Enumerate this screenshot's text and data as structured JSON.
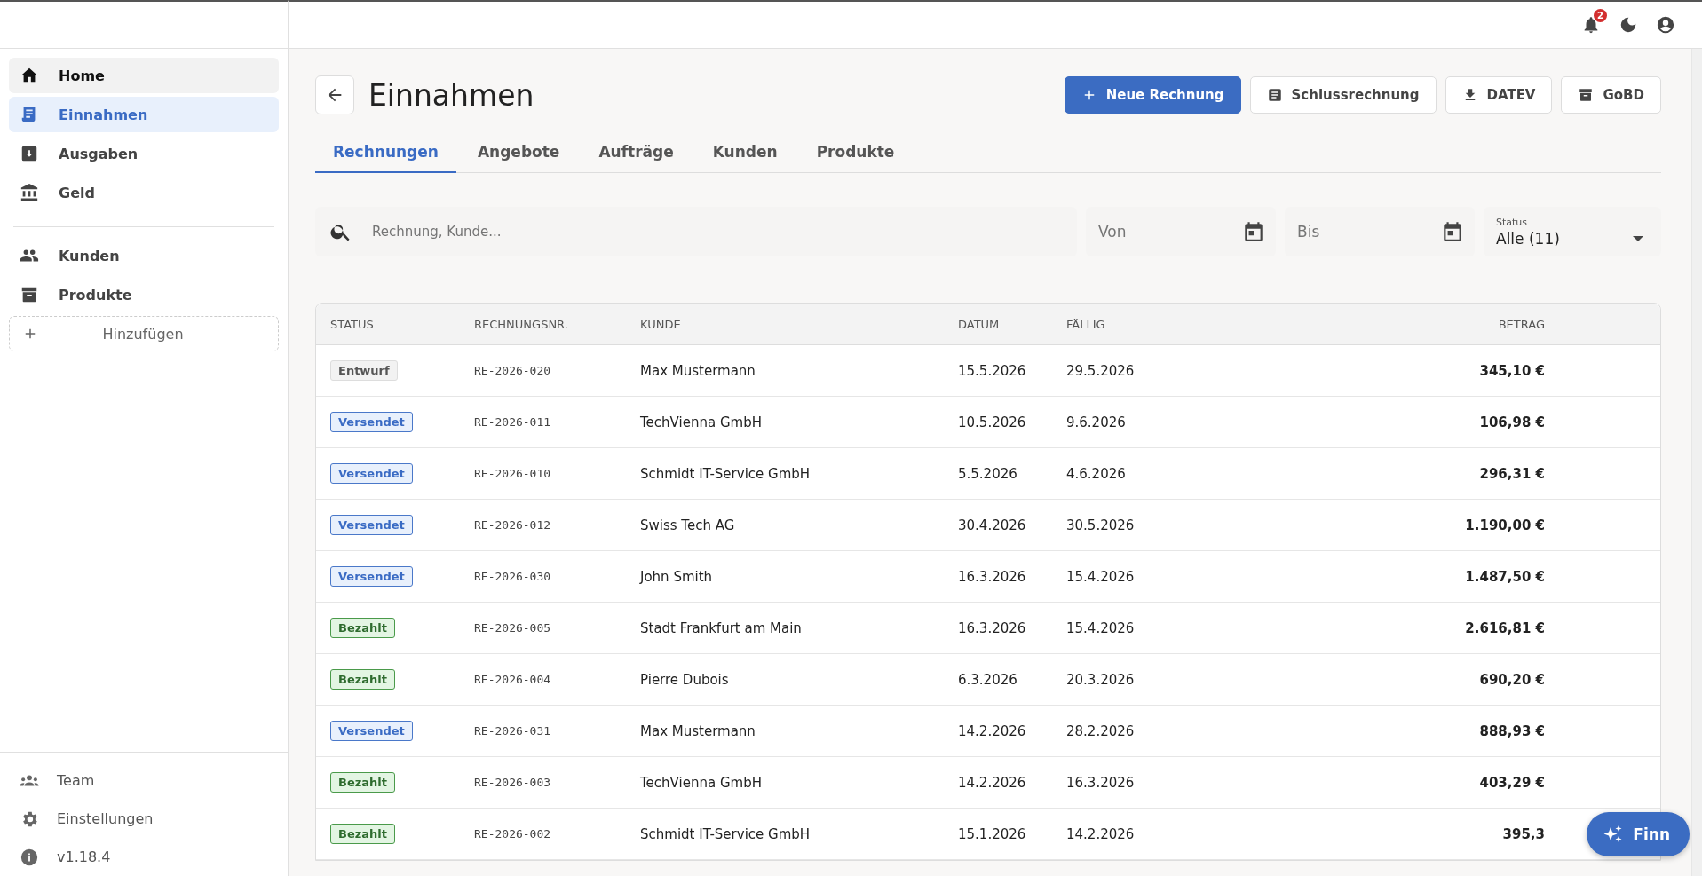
{
  "topbar": {
    "notifications_count": "2"
  },
  "sidebar": {
    "items": [
      {
        "label": "Home",
        "selected": false,
        "highlighted": true
      },
      {
        "label": "Einnahmen",
        "selected": true,
        "highlighted": false
      },
      {
        "label": "Ausgaben",
        "selected": false,
        "highlighted": false
      },
      {
        "label": "Geld",
        "selected": false,
        "highlighted": false
      }
    ],
    "items_2": [
      {
        "label": "Kunden",
        "selected": false,
        "highlighted": false
      },
      {
        "label": "Produkte",
        "selected": false,
        "highlighted": false
      }
    ],
    "add_button": "Hinzufügen",
    "footer": [
      {
        "label": "Team"
      },
      {
        "label": "Einstellungen"
      },
      {
        "label": "v1.18.4"
      }
    ]
  },
  "page": {
    "title": "Einnahmen",
    "actions": [
      {
        "label": "Neue Rechnung",
        "kind": "primary"
      },
      {
        "label": "Schlussrechnung",
        "kind": "secondary"
      },
      {
        "label": "DATEV",
        "kind": "secondary"
      },
      {
        "label": "GoBD",
        "kind": "secondary"
      }
    ],
    "tabs": [
      {
        "label": "Rechnungen",
        "selected": true
      },
      {
        "label": "Angebote",
        "selected": false
      },
      {
        "label": "Aufträge",
        "selected": false
      },
      {
        "label": "Kunden",
        "selected": false
      },
      {
        "label": "Produkte",
        "selected": false
      }
    ],
    "filters": {
      "search": {
        "placeholder": "Rechnung, Kunde..."
      },
      "from": {
        "placeholder": "Von"
      },
      "to": {
        "placeholder": "Bis"
      },
      "status": {
        "label": "Status",
        "value": "Alle (11)"
      }
    }
  },
  "table": {
    "columns": [
      "STATUS",
      "RECHNUNGSNR.",
      "KUNDE",
      "DATUM",
      "FÄLLIG",
      "BETRAG"
    ],
    "rows": [
      {
        "status": "Entwurf",
        "kind": "draft",
        "number": "RE-2026-020",
        "customer": "Max Mustermann",
        "date": "15.5.2026",
        "due": "29.5.2026",
        "amount": "345,10 €"
      },
      {
        "status": "Versendet",
        "kind": "sent",
        "number": "RE-2026-011",
        "customer": "TechVienna GmbH",
        "date": "10.5.2026",
        "due": "9.6.2026",
        "amount": "106,98 €"
      },
      {
        "status": "Versendet",
        "kind": "sent",
        "number": "RE-2026-010",
        "customer": "Schmidt IT-Service GmbH",
        "date": "5.5.2026",
        "due": "4.6.2026",
        "amount": "296,31 €"
      },
      {
        "status": "Versendet",
        "kind": "sent",
        "number": "RE-2026-012",
        "customer": "Swiss Tech AG",
        "date": "30.4.2026",
        "due": "30.5.2026",
        "amount": "1.190,00 €"
      },
      {
        "status": "Versendet",
        "kind": "sent",
        "number": "RE-2026-030",
        "customer": "John Smith",
        "date": "16.3.2026",
        "due": "15.4.2026",
        "amount": "1.487,50 €"
      },
      {
        "status": "Bezahlt",
        "kind": "paid",
        "number": "RE-2026-005",
        "customer": "Stadt Frankfurt am Main",
        "date": "16.3.2026",
        "due": "15.4.2026",
        "amount": "2.616,81 €"
      },
      {
        "status": "Bezahlt",
        "kind": "paid",
        "number": "RE-2026-004",
        "customer": "Pierre Dubois",
        "date": "6.3.2026",
        "due": "20.3.2026",
        "amount": "690,20 €"
      },
      {
        "status": "Versendet",
        "kind": "sent",
        "number": "RE-2026-031",
        "customer": "Max Mustermann",
        "date": "14.2.2026",
        "due": "28.2.2026",
        "amount": "888,93 €"
      },
      {
        "status": "Bezahlt",
        "kind": "paid",
        "number": "RE-2026-003",
        "customer": "TechVienna GmbH",
        "date": "14.2.2026",
        "due": "16.3.2026",
        "amount": "403,29 €"
      },
      {
        "status": "Bezahlt",
        "kind": "paid",
        "number": "RE-2026-002",
        "customer": "Schmidt IT-Service GmbH",
        "date": "15.1.2026",
        "due": "14.2.2026",
        "amount": "395,3"
      }
    ]
  },
  "assistant_button": {
    "label": "Finn"
  }
}
